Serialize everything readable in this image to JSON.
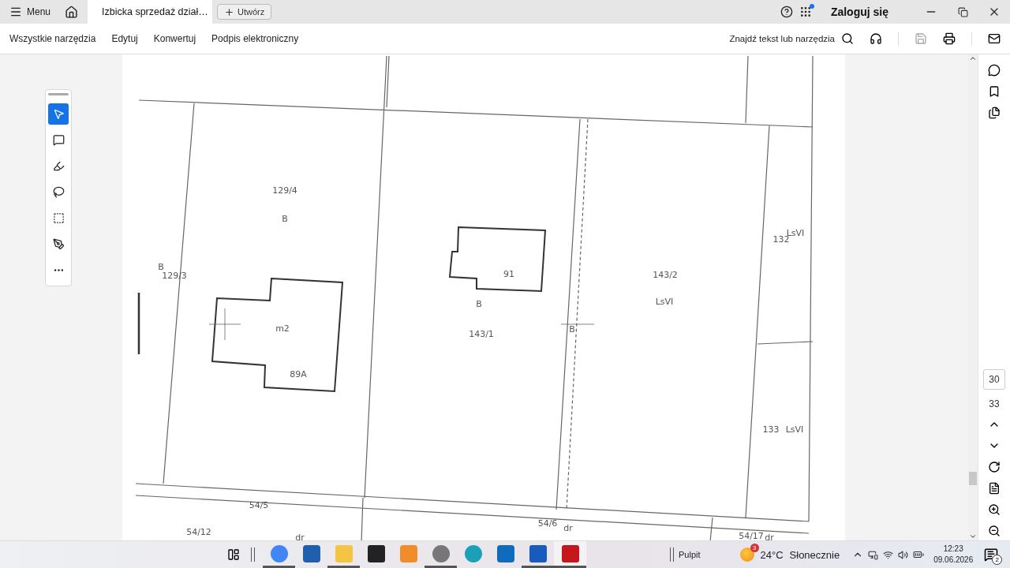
{
  "tab_bar": {
    "menu_label": "Menu",
    "tabs": [
      {
        "title": "Izbicka sprzedaż dział…",
        "selected": true
      }
    ],
    "new_button": "Utwórz",
    "login": "Zaloguj się"
  },
  "toolbar": {
    "items": [
      "Wszystkie narzędzia",
      "Edytuj",
      "Konwertuj",
      "Podpis elektroniczny"
    ],
    "search_placeholder": "Znajdź tekst lub narzędzia"
  },
  "left_tools": [
    {
      "kind": "select",
      "selected": true
    },
    {
      "kind": "comment",
      "selected": false
    },
    {
      "kind": "highlight",
      "selected": false
    },
    {
      "kind": "lasso",
      "selected": false
    },
    {
      "kind": "textbox",
      "selected": false
    },
    {
      "kind": "sign",
      "selected": false
    },
    {
      "kind": "more",
      "selected": false
    }
  ],
  "map": {
    "labels": [
      "129/4",
      "B",
      "B",
      "129/3",
      "m2",
      "89A",
      "91",
      "B",
      "143/1",
      "B",
      "143/2",
      "LsVI",
      "132",
      "LsVI",
      "133",
      "LsVI",
      "54/5",
      "54/6",
      "dr",
      "54/17",
      "dr",
      "54/12",
      "dr"
    ]
  },
  "right_rail": {
    "page_current": "30",
    "page_total": "33"
  },
  "taskbar": {
    "apps": [
      {
        "kind": "chrome",
        "running": true
      },
      {
        "kind": "store",
        "running": false
      },
      {
        "kind": "files",
        "running": true
      },
      {
        "kind": "audio",
        "running": false
      },
      {
        "kind": "player",
        "running": false
      },
      {
        "kind": "capture",
        "running": true
      },
      {
        "kind": "edge",
        "running": false
      },
      {
        "kind": "outlook",
        "running": false
      },
      {
        "kind": "word",
        "running": true
      },
      {
        "kind": "acrobat",
        "running": true
      }
    ],
    "desktop_label": "Pulpit",
    "weather": {
      "temp": "24°C",
      "condition": "Słonecznie",
      "badge": "3"
    },
    "time": "12:23",
    "date": "09.06.2026",
    "notifications": "2"
  }
}
